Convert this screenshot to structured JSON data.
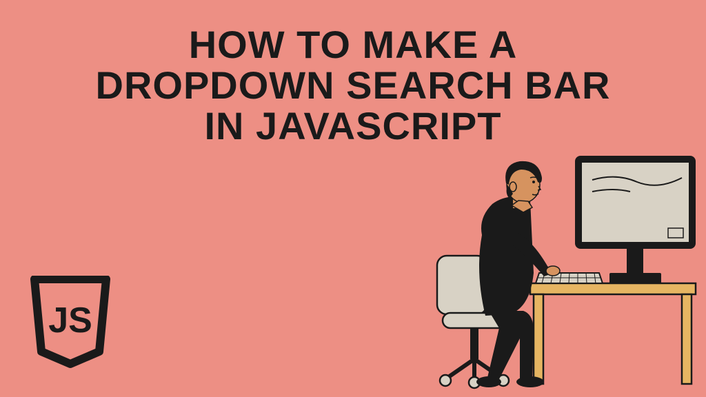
{
  "title": "HOW TO MAKE A DROPDOWN SEARCH BAR IN JAVASCRIPT",
  "logo_text": "JS",
  "colors": {
    "background": "#ed8f84",
    "text": "#1a1a1a",
    "desk": "#e6b562",
    "monitor_frame": "#1a1a1a",
    "monitor_screen": "#d8d2c5",
    "person_clothing": "#1a1a1a",
    "person_skin": "#d6935f",
    "keyboard": "#d8d2c5",
    "chair": "#d8d2c5"
  }
}
